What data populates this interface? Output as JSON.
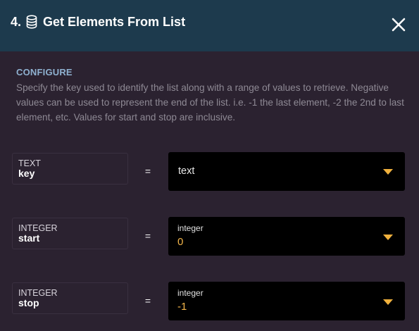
{
  "header": {
    "step_number": "4.",
    "title": "Get Elements From List",
    "icon": "database-icon",
    "close_icon": "close-icon"
  },
  "configure": {
    "heading": "CONFIGURE",
    "description": "Specify the key used to identify the list along with a range of values to retrieve. Negative values can be used to represent the end of the list. i.e. -1 the last element, -2 the 2nd to last element, etc. Values for start and stop are inclusive."
  },
  "params": [
    {
      "type": "TEXT",
      "name": "key",
      "operator": "=",
      "field_label": "",
      "value": "text"
    },
    {
      "type": "INTEGER",
      "name": "start",
      "operator": "=",
      "field_label": "integer",
      "value": "0"
    },
    {
      "type": "INTEGER",
      "name": "stop",
      "operator": "=",
      "field_label": "integer",
      "value": "-1"
    }
  ],
  "colors": {
    "header_bg": "#1d3a4d",
    "panel_bg": "#2b2230",
    "accent": "#f0b13d",
    "heading": "#8fb1d0"
  }
}
